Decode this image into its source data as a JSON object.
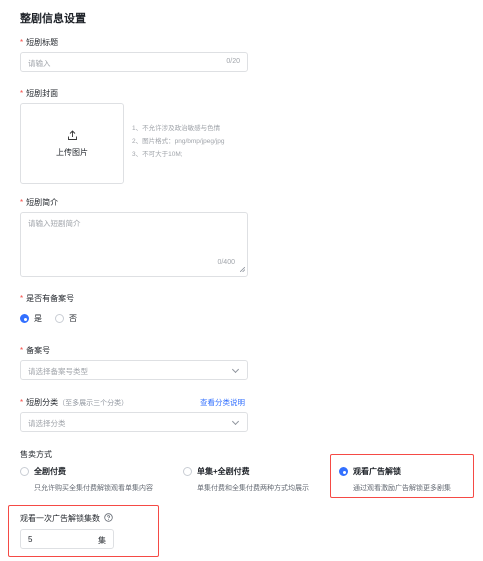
{
  "page": {
    "title": "整剧信息设置"
  },
  "drama_title": {
    "required_mark": "*",
    "label": "短剧标题",
    "placeholder": "请输入",
    "counter": "0/20"
  },
  "drama_cover": {
    "required_mark": "*",
    "label": "短剧封面",
    "upload_label": "上传图片",
    "upload_icon": "upload-icon",
    "requirements": [
      "1、不允许涉及政治敏感与色情",
      "2、图片格式：png/bmp/jpeg/jpg",
      "3、不可大于10M;"
    ]
  },
  "drama_intro": {
    "required_mark": "*",
    "label": "短剧简介",
    "placeholder": "请输入短剧简介",
    "counter": "0/400"
  },
  "has_filing": {
    "required_mark": "*",
    "label": "是否有备案号",
    "options": [
      {
        "label": "是",
        "selected": true
      },
      {
        "label": "否",
        "selected": false
      }
    ]
  },
  "filing_number": {
    "required_mark": "*",
    "label": "备案号",
    "placeholder": "请选择备案号类型"
  },
  "drama_category": {
    "required_mark": "*",
    "label": "短剧分类",
    "note": "（至多展示三个分类）",
    "link": "查看分类说明",
    "placeholder": "请选择分类"
  },
  "sale_mode": {
    "label": "售卖方式",
    "options": [
      {
        "title": "全剧付费",
        "desc": "只允许购买全集付费解锁观看单集内容",
        "selected": false
      },
      {
        "title": "单集+全剧付费",
        "desc": "单集付费和全集付费两种方式均展示",
        "selected": false
      },
      {
        "title": "观看广告解锁",
        "desc": "通过观看激励广告解锁更多剧集",
        "selected": true
      }
    ]
  },
  "ad_unlock": {
    "label": "观看一次广告解锁集数",
    "help_icon": "question-circle-icon",
    "value": "5",
    "unit": "集"
  },
  "colors": {
    "primary": "#3370ff",
    "required": "#f54a45",
    "highlight_border": "#f54a45"
  }
}
